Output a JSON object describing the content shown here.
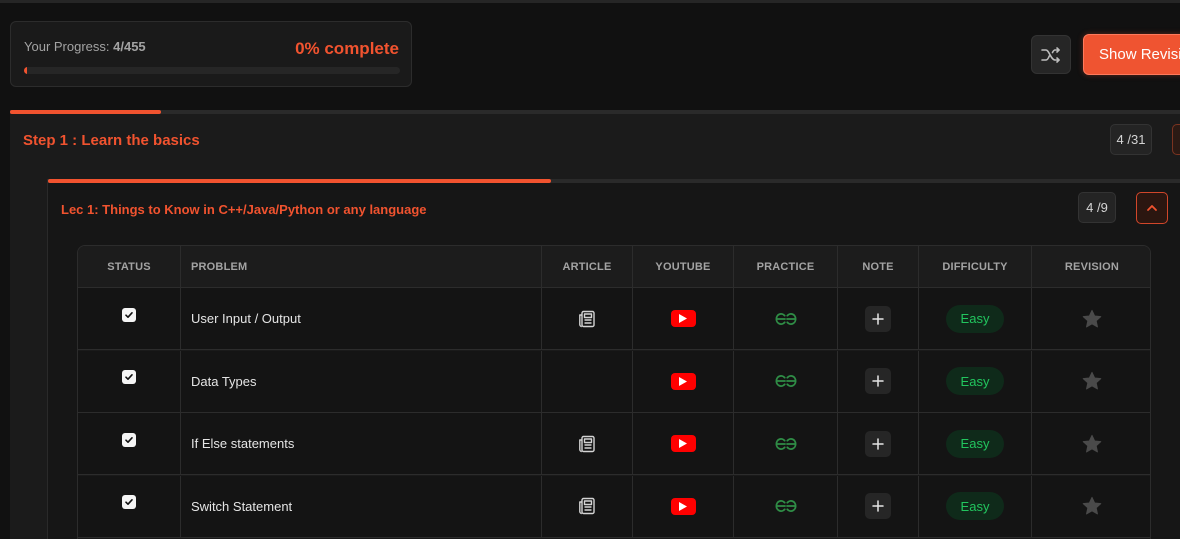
{
  "progress": {
    "label": "Your Progress: ",
    "count": "4/455",
    "percent_text": "0% complete",
    "fraction": 0.009
  },
  "toolbar": {
    "shuffle_icon": "shuffle-icon",
    "revision_button_label": "Show Revision"
  },
  "step": {
    "title": "Step 1 : Learn the basics",
    "count": "4 /31",
    "progress_fraction": 0.129
  },
  "lecture": {
    "title": "Lec 1: Things to Know in C++/Java/Python or any language",
    "count": "4 /9",
    "progress_fraction": 0.444
  },
  "table": {
    "headers": {
      "status": "STATUS",
      "problem": "PROBLEM",
      "article": "ARTICLE",
      "youtube": "YOUTUBE",
      "practice": "PRACTICE",
      "note": "NOTE",
      "difficulty": "DIFFICULTY",
      "revision": "REVISION"
    },
    "rows": [
      {
        "problem": "User Input / Output",
        "checked": true,
        "has_article": true,
        "difficulty": "Easy"
      },
      {
        "problem": "Data Types",
        "checked": true,
        "has_article": false,
        "difficulty": "Easy"
      },
      {
        "problem": "If Else statements",
        "checked": true,
        "has_article": true,
        "difficulty": "Easy"
      },
      {
        "problem": "Switch Statement",
        "checked": true,
        "has_article": true,
        "difficulty": "Easy"
      }
    ]
  },
  "colors": {
    "accent": "#f1532f",
    "easy": "#22c55e",
    "youtube": "#ff0000",
    "gfg": "#2f8d46"
  }
}
